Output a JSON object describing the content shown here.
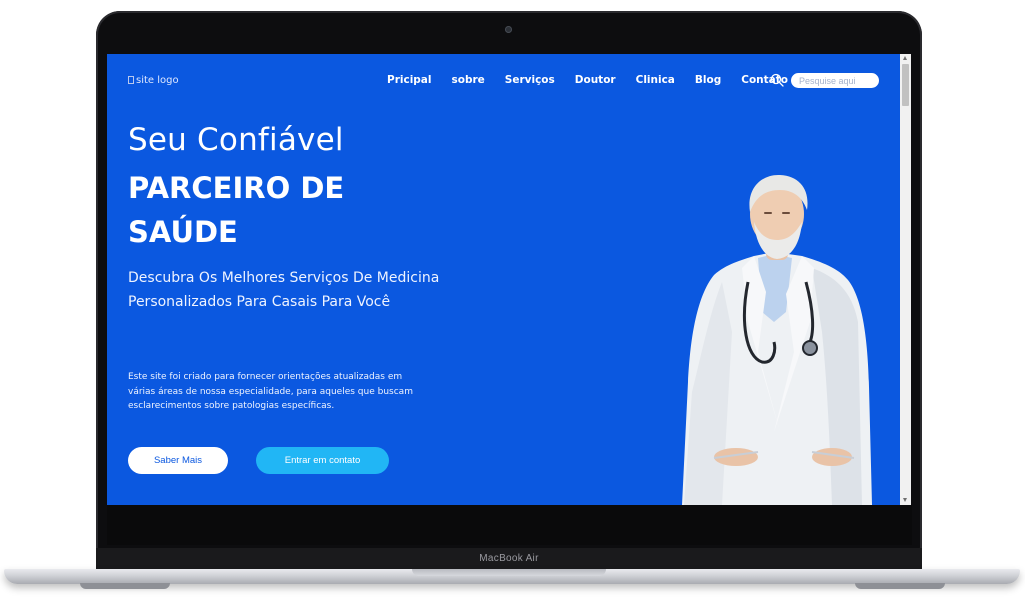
{
  "device": {
    "model_label": "MacBook Air"
  },
  "site": {
    "logo_alt": "site logo",
    "nav": [
      {
        "label": "Pricipal"
      },
      {
        "label": "sobre"
      },
      {
        "label": "Serviços"
      },
      {
        "label": "Doutor"
      },
      {
        "label": "Clinica"
      },
      {
        "label": "Blog"
      },
      {
        "label": "Contato"
      }
    ],
    "search": {
      "placeholder": "Pesquise aqui"
    },
    "hero": {
      "title_light": "Seu Confiável",
      "title_bold_line1": "PARCEIRO DE",
      "title_bold_line2": "SAÚDE",
      "subtitle": "Descubra Os Melhores Serviços De Medicina Personalizados Para Casais Para Você",
      "description": "Este site foi criado para fornecer orientações atualizadas em várias áreas de nossa especialidade, para aqueles que buscam esclarecimentos sobre patologias específicas.",
      "btn_primary": "Saber Mais",
      "btn_secondary": "Entrar em contato"
    },
    "colors": {
      "hero_bg": "#0b58e0",
      "accent_button": "#21b6f5",
      "white": "#ffffff"
    },
    "icons": {
      "search": "search-icon",
      "doctor": "doctor-illustration"
    }
  }
}
